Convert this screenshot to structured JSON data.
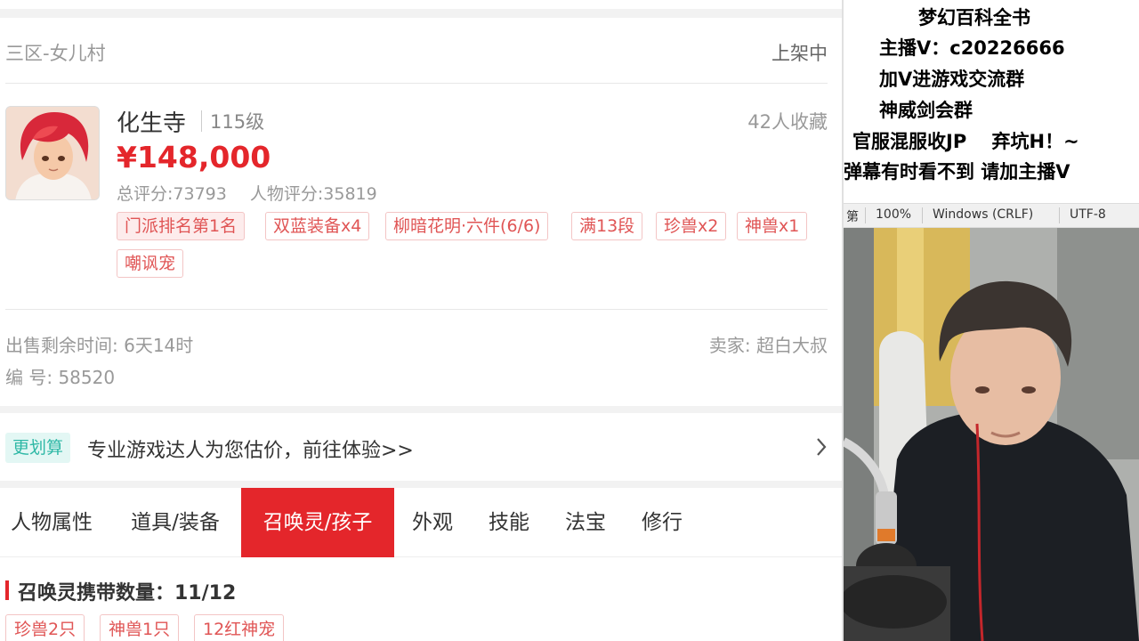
{
  "listing": {
    "server": "三区-女儿村",
    "status": "上架中",
    "sect": "化生寺",
    "level": "115级",
    "favorites": "42人收藏",
    "price": "¥148,000",
    "total_score": "总评分:73793",
    "char_score": "人物评分:35819",
    "tags": [
      "门派排名第1名",
      "双蓝装备x4",
      "柳暗花明·六件(6/6)",
      "满13段",
      "珍兽x2",
      "神兽x1",
      "嘲讽宠"
    ],
    "sale_time": "出售剩余时间: 6天14时",
    "seller": "卖家: 超白大叔",
    "code": "编 号: 58520"
  },
  "promo": {
    "badge": "更划算",
    "text": "专业游戏达人为您估价，前往体验>>"
  },
  "tabs": [
    "人物属性",
    "道具/装备",
    "召唤灵/孩子",
    "外观",
    "技能",
    "法宝",
    "修行"
  ],
  "active_tab": "召唤灵/孩子",
  "pets": {
    "title": "召唤灵携带数量：11/12",
    "tags": [
      "珍兽2只",
      "神兽1只",
      "12红神宠"
    ]
  },
  "overlay": {
    "lines": [
      "梦幻百科全书",
      "主播V：c20226666",
      "加V进游戏交流群",
      "神威剑会群",
      "官服混服收JP　 弃坑H！~",
      "弹幕有时看不到 请加主播V"
    ]
  },
  "editor_status": {
    "line_fragment": "第",
    "zoom": "100%",
    "line_ending": "Windows (CRLF)",
    "encoding": "UTF-8"
  },
  "colors": {
    "accent": "#e4262b",
    "tag_text": "#e05555",
    "promo_badge": "#2fb8a6"
  }
}
